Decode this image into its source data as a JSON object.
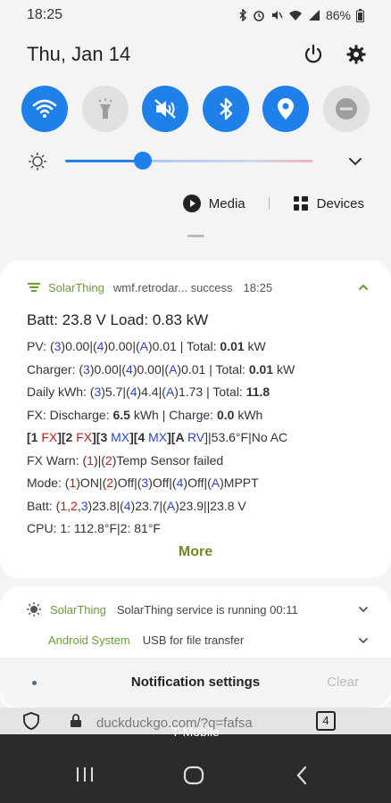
{
  "status_bar": {
    "time": "18:25",
    "battery": "86%"
  },
  "header": {
    "date": "Thu, Jan 14"
  },
  "quick_toggles": [
    {
      "name": "wifi",
      "on": true
    },
    {
      "name": "flashlight",
      "on": false
    },
    {
      "name": "mute",
      "on": true
    },
    {
      "name": "bluetooth",
      "on": true
    },
    {
      "name": "location",
      "on": true
    },
    {
      "name": "do-not-disturb",
      "on": false
    }
  ],
  "brightness": {
    "level": 0.32
  },
  "media_bar": {
    "media_label": "Media",
    "devices_label": "Devices"
  },
  "notification": {
    "app": "SolarThing",
    "source": "wmf.retrodar... success",
    "time": "18:25",
    "title": "Batt: 23.8 V Load: 0.83 kW",
    "pv": {
      "p": "PV: ",
      "a": "(",
      "b": "3",
      "c": ")0.00|(",
      "d": "4",
      "e": ")0.00|(",
      "f": "A",
      "g": ")0.01 | Total: ",
      "h": "0.01",
      "i": " kW"
    },
    "charger": {
      "p": "Charger: ",
      "a": "(",
      "b": "3",
      "c": ")0.00|(",
      "d": "4",
      "e": ")0.00|(",
      "f": "A",
      "g": ")0.01 | Total: ",
      "h": "0.01",
      "i": " kW"
    },
    "daily": {
      "p": "Daily kWh: ",
      "a": "(",
      "b": "3",
      "c": ")5.7|(",
      "d": "4",
      "e": ")4.4|(",
      "f": "A",
      "g": ")1.73 | Total: ",
      "h": "11.8"
    },
    "fx": {
      "p": "FX: Discharge: ",
      "a": "6.5",
      "b": " kWh | Charge: ",
      "c": "0.0",
      "d": " kWh"
    },
    "devices": {
      "a": "[1 ",
      "b": "FX",
      "c": "][2 ",
      "d": "FX",
      "e": "][3 ",
      "f": "MX",
      "g": "][4 ",
      "h": "MX",
      "i": "][A ",
      "j": "RV",
      "k": "]|53.6°F|No AC"
    },
    "warn": {
      "p": "FX Warn: (",
      "a": "1",
      "b": ")|(",
      "c": "2",
      "d": ")Temp Sensor failed"
    },
    "mode": {
      "p": "Mode: (",
      "a": "1",
      "b": ")ON|(",
      "c": "2",
      "d": ")Off|(",
      "e": "3",
      "f": ")Off|(",
      "g": "4",
      "h": ")Off|(",
      "i": "A",
      "j": ")MPPT"
    },
    "batt": {
      "p": "Batt: (",
      "a": "1",
      "b": ",",
      "c": "2",
      "d": ",",
      "e": "3",
      "f": ")23.8|(",
      "g": "4",
      "h": ")23.7|(",
      "i": "A",
      "j": ")23.9||23.8 V"
    },
    "cpu": "CPU: 1: 112.8°F|2: 81°F",
    "more_label": "More"
  },
  "service_notifications": [
    {
      "app": "SolarThing",
      "text": "SolarThing service is running 00:11"
    },
    {
      "app": "Android System",
      "text": "USB for file transfer"
    }
  ],
  "footer": {
    "settings_label": "Notification settings",
    "clear_label": "Clear"
  },
  "browser": {
    "url": "duckduckgo.com/?q=fafsa",
    "tab_count": "4"
  },
  "carrier": "T-Mobile"
}
